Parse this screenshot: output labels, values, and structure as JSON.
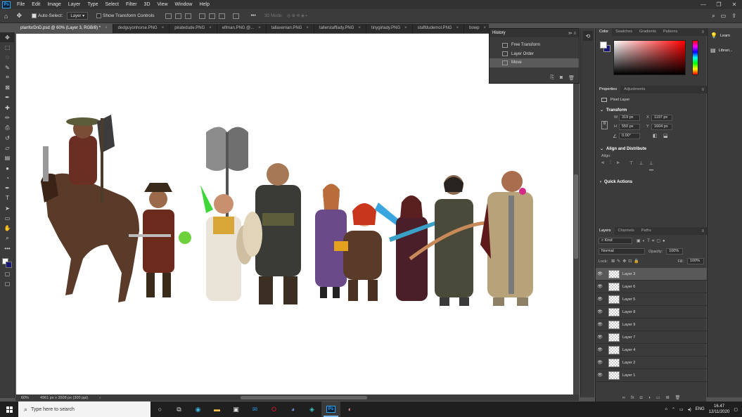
{
  "app": {
    "name": "Photoshop",
    "logo_text": "Ps"
  },
  "menu": [
    "File",
    "Edit",
    "Image",
    "Layer",
    "Type",
    "Select",
    "Filter",
    "3D",
    "View",
    "Window",
    "Help"
  ],
  "window_controls": [
    "—",
    "❐",
    "✕"
  ],
  "options_bar": {
    "auto_select_label": "Auto-Select:",
    "auto_select_value": "Layer",
    "show_transform_label": "Show Transform Controls",
    "mode_3d_label": "3D Mode:"
  },
  "tools": [
    "move",
    "marquee",
    "lasso",
    "quick-select",
    "crop",
    "frame",
    "eyedropper",
    "healing",
    "brush",
    "stamp",
    "history-brush",
    "eraser",
    "gradient",
    "blur",
    "dodge",
    "pen",
    "type",
    "path-select",
    "shape",
    "hand",
    "zoom",
    "more"
  ],
  "doc_tabs": [
    {
      "label": "planforDnD.psd @ 60% (Layer 3, RGB/8) *",
      "active": true
    },
    {
      "label": "dedguyonhorse.PNG",
      "active": false
    },
    {
      "label": "piratedude.PNG",
      "active": false
    },
    {
      "label": "elfman.PNG @...",
      "active": false
    },
    {
      "label": "tallaxeman.PNG",
      "active": false
    },
    {
      "label": "tallerstafflady.PNG",
      "active": false
    },
    {
      "label": "tinygirlady.PNG",
      "active": false
    },
    {
      "label": "staffdudemol.PNG",
      "active": false
    },
    {
      "label": "bowp",
      "active": false
    }
  ],
  "history": {
    "title": "History",
    "items": [
      {
        "label": "Free Transform",
        "selected": false
      },
      {
        "label": "Layer Order",
        "selected": false
      },
      {
        "label": "Move",
        "selected": true
      }
    ]
  },
  "color_panel": {
    "tabs": [
      "Color",
      "Swatches",
      "Gradients",
      "Patterns"
    ],
    "foreground": "#ffffff",
    "background": "#1a1877"
  },
  "properties": {
    "tabs": [
      "Properties",
      "Adjustments"
    ],
    "kind": "Pixel Layer",
    "transform_title": "Transform",
    "w_label": "W",
    "w_value": "319 px",
    "x_label": "X",
    "x_value": "1197 px",
    "h_label": "H",
    "h_value": "550 px",
    "y_label": "Y",
    "y_value": "1604 px",
    "angle_value": "0.00°",
    "align_title": "Align and Distribute",
    "align_label": "Align:",
    "more": "•••",
    "quick_actions": "Quick Actions"
  },
  "layers_panel": {
    "tabs": [
      "Layers",
      "Channels",
      "Paths"
    ],
    "filter_kind": "Kind",
    "blend_mode": "Normal",
    "opacity_label": "Opacity:",
    "opacity_value": "100%",
    "lock_label": "Lock:",
    "fill_label": "Fill:",
    "fill_value": "100%",
    "layers": [
      {
        "name": "Layer 3",
        "selected": true
      },
      {
        "name": "Layer 6",
        "selected": false
      },
      {
        "name": "Layer 5",
        "selected": false
      },
      {
        "name": "Layer 8",
        "selected": false
      },
      {
        "name": "Layer 9",
        "selected": false
      },
      {
        "name": "Layer 7",
        "selected": false
      },
      {
        "name": "Layer 4",
        "selected": false
      },
      {
        "name": "Layer 2",
        "selected": false
      },
      {
        "name": "Layer 1",
        "selected": false
      }
    ]
  },
  "learn": {
    "learn_label": "Learn",
    "libraries_label": "Librari..."
  },
  "status": {
    "zoom": "60%",
    "doc_info": "4961 px x 3508 px (300 ppi)"
  },
  "taskbar": {
    "search_placeholder": "Type here to search",
    "apps": [
      "cortana",
      "task-view",
      "edge",
      "file-explorer",
      "store",
      "mail",
      "opera",
      "discord",
      "app-dark",
      "photoshop",
      "app-browser"
    ],
    "language": "ENG",
    "time": "16.47",
    "date": "12/11/2020"
  },
  "colors": {
    "app_bg": "#535353",
    "panel_bg": "#3b3b3b",
    "menu_bg": "#323232",
    "taskbar_bg": "#1f1f1f",
    "accent_blue": "#31a8ff"
  }
}
